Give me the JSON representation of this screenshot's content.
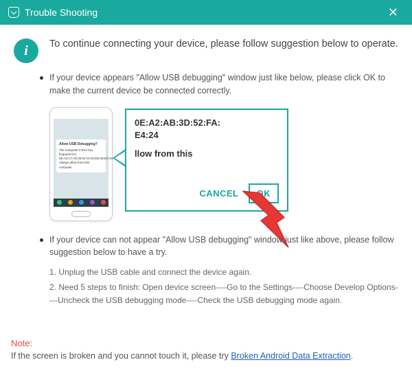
{
  "titlebar": {
    "title": "Trouble Shooting"
  },
  "info": {
    "icon_label": "i",
    "intro": "To continue connecting your device, please follow suggestion below to operate."
  },
  "bullets": {
    "b1": "If your device appears \"Allow USB debugging\" window just like below, please click OK to make the current device  be connected correctly.",
    "b2": "If your device can not appear \"Allow USB debugging\" window just like above, please follow suggestion below to have a try."
  },
  "phone_dialog": {
    "title": "Allow USB Debugging?",
    "body": "The computer's RSA key fingerprint is: 0E:A2:C7:A5:36:52:C0:53:E8:46:EC:04 Always allow from this computer"
  },
  "callout": {
    "mac_line1": "0E:A2:AB:3D:52:FA:",
    "mac_line2": "E4:24",
    "allow_text": "llow from this",
    "cancel": "CANCEL",
    "ok": "OK"
  },
  "steps": {
    "s1": "1. Unplug the USB cable and connect the device again.",
    "s2": "2. Need 5 steps to finish: Open device screen----Go to the Settings----Choose Develop Options----Uncheck the USB debugging mode----Check the USB debugging mode again."
  },
  "note": {
    "label": "Note:",
    "text_before": "If the screen is broken and you cannot touch it, please try ",
    "link": "Broken Android Data Extraction",
    "text_after": "."
  }
}
